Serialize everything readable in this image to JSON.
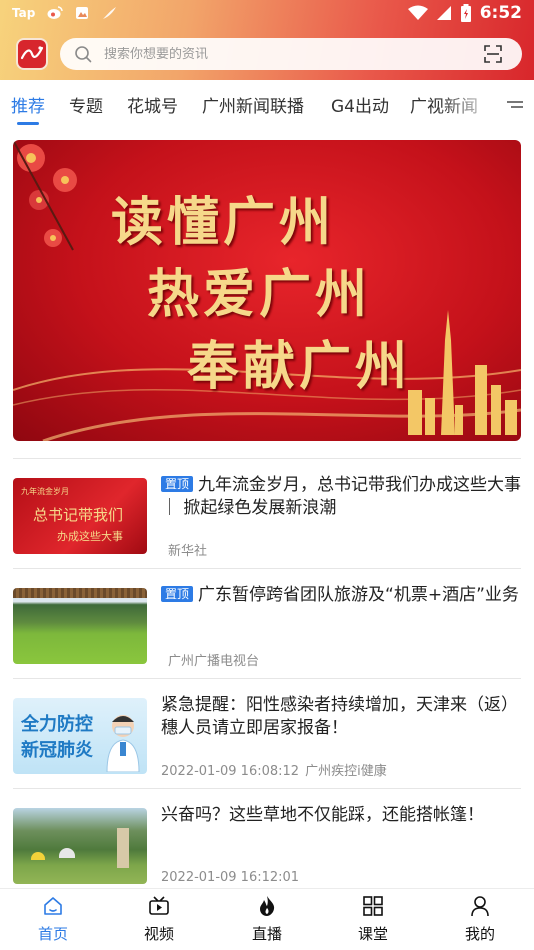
{
  "status_bar": {
    "left_items": [
      "Tap",
      "weibo-icon",
      "photo-icon",
      "feather-icon"
    ],
    "time": "6:52"
  },
  "search": {
    "placeholder": "搜索你想要的资讯",
    "value": ""
  },
  "tabs": [
    {
      "label": "推荐",
      "active": true
    },
    {
      "label": "专题",
      "active": false
    },
    {
      "label": "花城号",
      "active": false
    },
    {
      "label": "广州新闻联播",
      "active": false
    },
    {
      "label": "G4出动",
      "active": false
    },
    {
      "label": "广视新闻",
      "active": false
    }
  ],
  "banner": {
    "lines": [
      "读懂广州",
      "热爱广州",
      "奉献广州"
    ]
  },
  "news": [
    {
      "pin_label": "置顶",
      "title": "九年流金岁月，总书记带我们办成这些大事 ｜ 掀起绿色发展新浪潮",
      "time": "",
      "source": "新华社",
      "thumb": {
        "caption_top": "九年流金岁月",
        "caption_main": "总书记带我们",
        "caption_sub": "办成这些大事"
      }
    },
    {
      "pin_label": "置顶",
      "title": "广东暂停跨省团队旅游及“机票+酒店”业务",
      "time": "",
      "source": "广州广播电视台",
      "thumb": {}
    },
    {
      "pin_label": "",
      "title": "紧急提醒：阳性感染者持续增加，天津来（返）穗人员请立即居家报备！",
      "time": "2022-01-09 16:08:12",
      "source": "广州疾控i健康",
      "thumb": {
        "caption_line1": "全力防控",
        "caption_line2": "新冠肺炎"
      }
    },
    {
      "pin_label": "",
      "title": "兴奋吗？这些草地不仅能踩，还能搭帐篷！",
      "time": "2022-01-09 16:12:01",
      "source": "",
      "thumb": {}
    }
  ],
  "bottom_nav": [
    {
      "label": "首页",
      "icon": "home-icon",
      "active": true
    },
    {
      "label": "视频",
      "icon": "video-icon",
      "active": false
    },
    {
      "label": "直播",
      "icon": "flame-icon",
      "active": false
    },
    {
      "label": "课堂",
      "icon": "grid-icon",
      "active": false
    },
    {
      "label": "我的",
      "icon": "user-icon",
      "active": false
    }
  ],
  "colors": {
    "accent": "#2d7be5",
    "header_start": "#f7d37c",
    "header_end": "#d8262b",
    "banner_red": "#c4111a",
    "banner_gold": "#f6d88a"
  }
}
